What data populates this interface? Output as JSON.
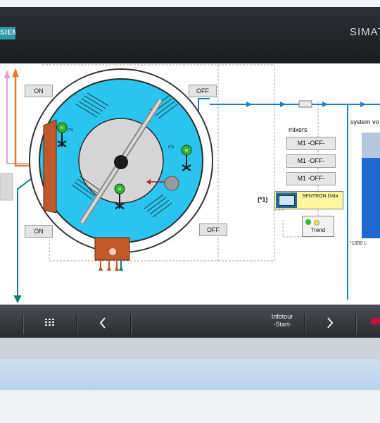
{
  "header": {
    "logo_text": "SIEMENS",
    "brand_text": "SIMATIC"
  },
  "process": {
    "on_button_top": "ON",
    "on_button_bottom": "ON",
    "off_button_top": "OFF",
    "off_button_bottom": "OFF",
    "motor_label": "M",
    "star_mark": "(*1)"
  },
  "mixers": {
    "title": "mixers",
    "items": [
      "M1 -OFF-",
      "M1 -OFF-",
      "M1 -OFF-"
    ]
  },
  "sentron": {
    "marker": "(*1)",
    "label": "SENTRON Data"
  },
  "trend": {
    "label": "Trend"
  },
  "system_volume": {
    "title": "system vo",
    "unit_label": "*1000 L",
    "fill_fraction": 0.76
  },
  "navbar": {
    "infotour_line1": "Infotour",
    "infotour_line2": "-Start-"
  },
  "colors": {
    "tank_blue": "#2ac4ef",
    "pipe_blue": "#1b7fd6",
    "level_blue": "#1f6ad0",
    "motor_green": "#2fb52f",
    "heater_orange": "#c0582a",
    "teal_pipe": "#157a80",
    "pink_pipe": "#e89ad0"
  },
  "icons": [
    "grid-icon",
    "chevron-left-icon",
    "chevron-right-icon",
    "flag-icon",
    "motor-icon",
    "valve-icon"
  ]
}
